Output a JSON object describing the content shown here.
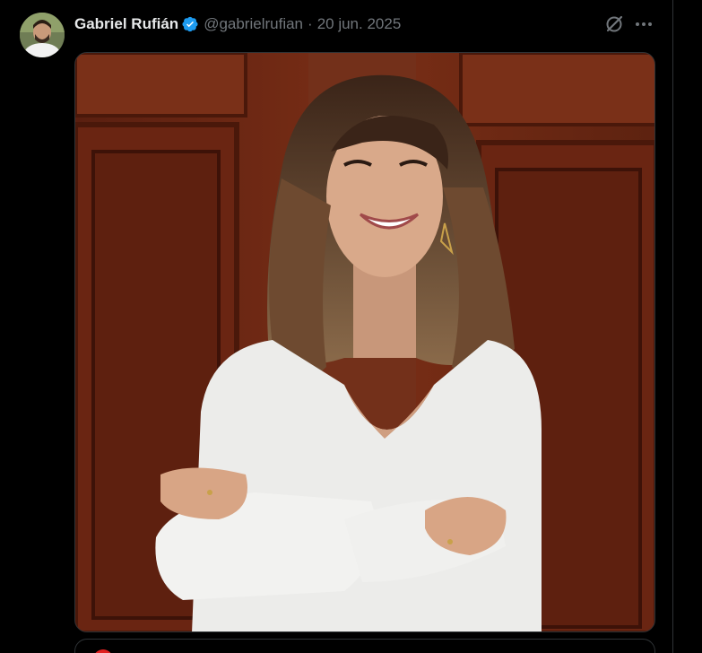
{
  "post": {
    "author": {
      "display_name": "Gabriel Rufián",
      "handle": "@gabrielrufian",
      "verified": true,
      "avatar_icon": "user-avatar"
    },
    "separator": "·",
    "date": "20 jun. 2025",
    "actions": {
      "grok_icon": "grok-icon",
      "more_icon": "more-horizontal-icon"
    },
    "media": {
      "type": "photo",
      "alt": ""
    }
  },
  "colors": {
    "background": "#000000",
    "text_primary": "#e7e9ea",
    "text_secondary": "#71767b",
    "verified_blue": "#1d9bf0",
    "border": "#2f3336"
  }
}
